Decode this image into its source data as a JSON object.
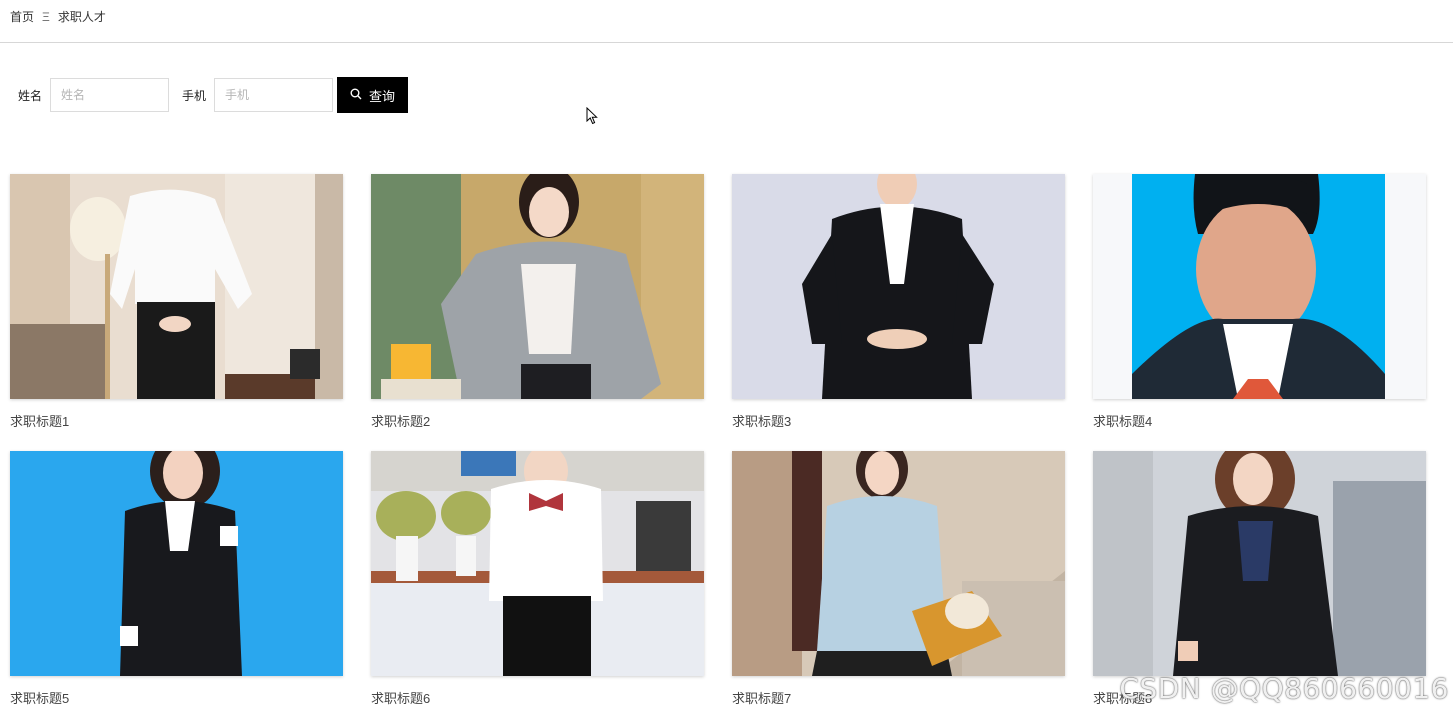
{
  "breadcrumb": {
    "home": "首页",
    "separator": "Ξ",
    "current": "求职人才"
  },
  "search": {
    "name_label": "姓名",
    "name_placeholder": "姓名",
    "phone_label": "手机",
    "phone_placeholder": "手机",
    "button_label": "查询"
  },
  "cards": [
    {
      "title": "求职标题1"
    },
    {
      "title": "求职标题2"
    },
    {
      "title": "求职标题3"
    },
    {
      "title": "求职标题4"
    },
    {
      "title": "求职标题5"
    },
    {
      "title": "求职标题6"
    },
    {
      "title": "求职标题7"
    },
    {
      "title": "求职标题8"
    }
  ],
  "watermark": "CSDN @QQ860660016",
  "colors": {
    "search_button": "#000000",
    "divider": "#d7d7d7",
    "photo4_background": "#00b0f0",
    "photo5_background": "#2aa7ee"
  }
}
